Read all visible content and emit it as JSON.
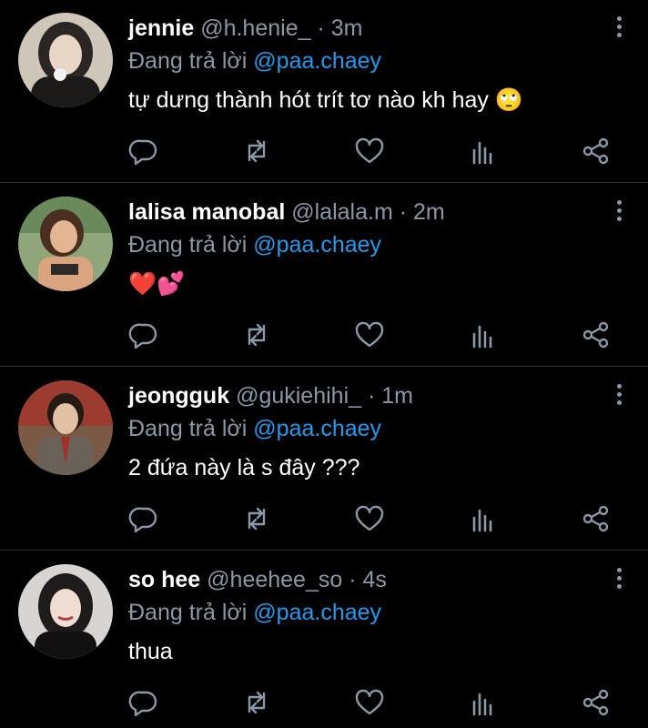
{
  "tweets": [
    {
      "name": "jennie",
      "handle": "@h.henie_",
      "time": "· 3m",
      "replying_prefix": "Đang trả lời",
      "replying_to": "@paa.chaey",
      "text": "tự dưng thành hót trít tơ nào kh hay 🙄"
    },
    {
      "name": "lalisa manobal",
      "handle": "@lalala.m",
      "time": "· 2m",
      "replying_prefix": "Đang trả lời",
      "replying_to": "@paa.chaey",
      "text": "❤️💕"
    },
    {
      "name": "jeongguk",
      "handle": "@gukiehihi_",
      "time": "· 1m",
      "replying_prefix": "Đang trả lời",
      "replying_to": "@paa.chaey",
      "text": "2 đứa này là s đây ???"
    },
    {
      "name": "so hee",
      "handle": "@heehee_so",
      "time": "· 4s",
      "replying_prefix": "Đang trả lời",
      "replying_to": "@paa.chaey",
      "text": "thua"
    }
  ],
  "icons": {
    "reply": "reply-icon",
    "retweet": "retweet-icon",
    "like": "heart-icon",
    "stats": "analytics-icon",
    "share": "share-icon",
    "more": "more-vertical-icon"
  },
  "colors": {
    "background": "#000000",
    "name": "#ffffff",
    "muted": "#8b98a5",
    "mention": "#1d9bf0",
    "divider": "#2f3336"
  }
}
